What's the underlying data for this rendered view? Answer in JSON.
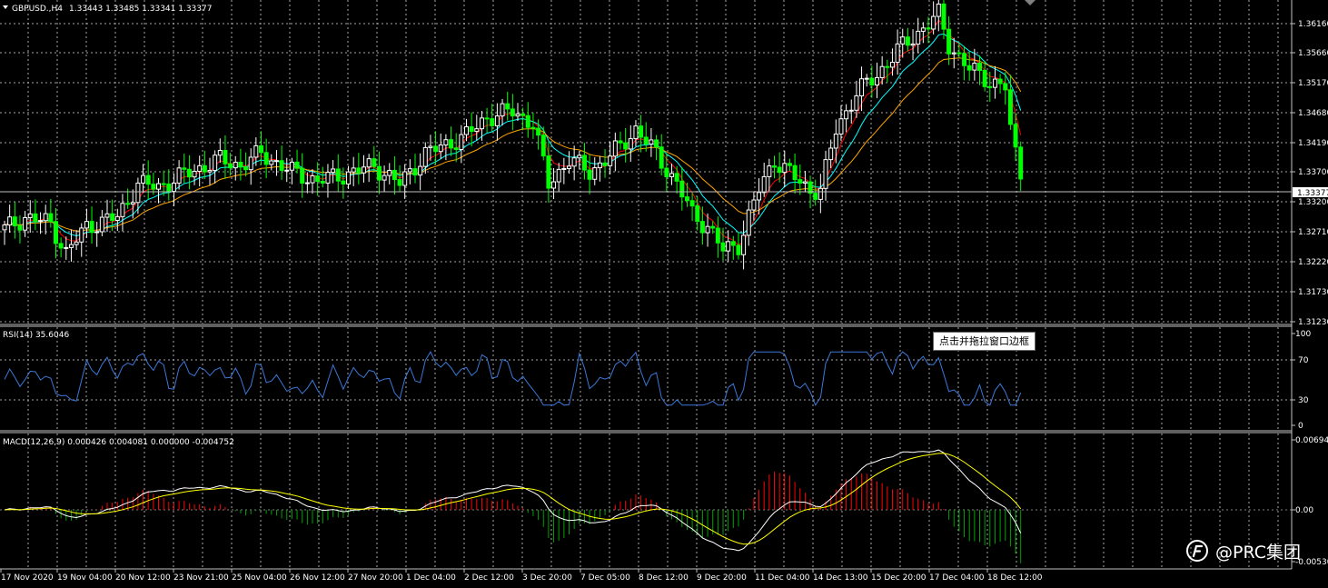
{
  "main": {
    "symbol_label": "GBPUSD.,H4",
    "ohlc_label": "1.33443 1.33485 1.33341 1.33377",
    "current_price": "1.33377",
    "price_ticks": [
      "1.36160",
      "1.35660",
      "1.35170",
      "1.34680",
      "1.34190",
      "1.33700",
      "1.33200",
      "1.32710",
      "1.32220",
      "1.31730",
      "1.31230"
    ]
  },
  "rsi": {
    "label": "RSI(14) 35.6046",
    "ticks": [
      "100",
      "70",
      "30",
      "0"
    ]
  },
  "macd": {
    "label": "MACD(12,26,9) 0.000426 0.004081 0.000000 -0.004752",
    "ticks": [
      "0.00694",
      "0.00",
      "-0.00530"
    ]
  },
  "time_axis": [
    "17 Nov 2020",
    "19 Nov 04:00",
    "20 Nov 12:00",
    "23 Nov 21:00",
    "25 Nov 04:00",
    "26 Nov 12:00",
    "27 Nov 20:00",
    "1 Dec 04:00",
    "2 Dec 12:00",
    "3 Dec 20:00",
    "7 Dec 05:00",
    "8 Dec 12:00",
    "9 Dec 20:00",
    "11 Dec 04:00",
    "14 Dec 13:00",
    "15 Dec 20:00",
    "17 Dec 04:00",
    "18 Dec 12:00"
  ],
  "tooltip": "点击并拖拉窗口边框",
  "watermark": "@PRC集团",
  "colors": {
    "background": "#000000",
    "grid": "#c0c0c0",
    "bull_candle": "#ffffff",
    "bear_candle": "#00ff00",
    "ma_fast": "#ff0000",
    "ma_mid": "#00ffff",
    "ma_slow": "#ffa500",
    "rsi_line": "#3c78d8",
    "macd_line": "#ffffff",
    "signal_line": "#ffff00",
    "hist_pos": "#ff0000",
    "hist_neg": "#00a000"
  },
  "chart_data": {
    "type": "candlestick",
    "symbol": "GBPUSD.",
    "timeframe": "H4",
    "price_range": [
      1.3099,
      1.3634
    ],
    "key_closes": [
      {
        "time": "17 Nov 2020",
        "close": 1.324
      },
      {
        "time": "26 Nov 12:00",
        "close": 1.336
      },
      {
        "time": "3 Dec 20:00",
        "close": 1.345
      },
      {
        "time": "11 Dec 04:00",
        "close": 1.318
      },
      {
        "time": "17 Dec 04:00",
        "close": 1.362
      },
      {
        "time": "18 Dec 12:00",
        "close": 1.33377
      }
    ],
    "rsi_last": 35.6046,
    "macd_last": {
      "main": 0.000426,
      "signal": 0.004081,
      "histogram": -0.004752
    }
  }
}
